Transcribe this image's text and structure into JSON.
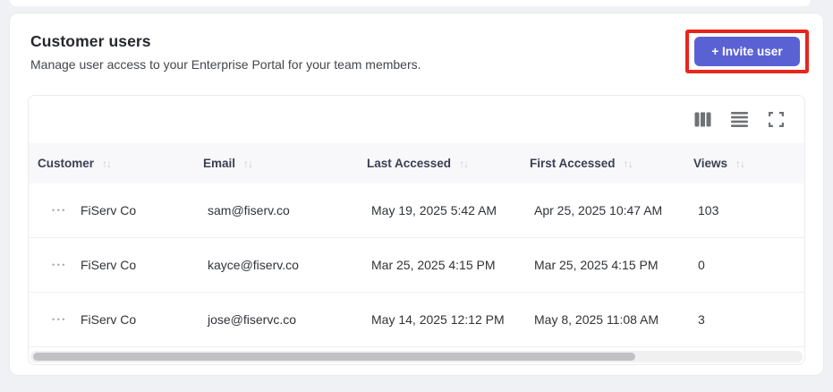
{
  "header": {
    "title": "Customer users",
    "subtitle": "Manage user access to your Enterprise Portal for your team members.",
    "invite_button_label": "+ Invite user"
  },
  "colors": {
    "accent": "#5a62d3",
    "annotation_red": "#e8251c",
    "header_row_bg": "#f8f8fb"
  },
  "toolbar": {
    "icons": [
      "columns-icon",
      "rows-icon",
      "fullscreen-icon"
    ]
  },
  "table": {
    "sort_icon": "↑↓",
    "row_menu_icon": "•••",
    "columns": [
      {
        "label": "Customer"
      },
      {
        "label": "Email"
      },
      {
        "label": "Last Accessed"
      },
      {
        "label": "First Accessed"
      },
      {
        "label": "Views"
      }
    ],
    "rows": [
      {
        "customer": "FiServ Co",
        "email": "sam@fiserv.co",
        "last_accessed": "May 19, 2025 5:42 AM",
        "first_accessed": "Apr 25, 2025 10:47 AM",
        "views": "103"
      },
      {
        "customer": "FiServ Co",
        "email": "kayce@fiserv.co",
        "last_accessed": "Mar 25, 2025 4:15 PM",
        "first_accessed": "Mar 25, 2025 4:15 PM",
        "views": "0"
      },
      {
        "customer": "FiServ Co",
        "email": "jose@fiservc.co",
        "last_accessed": "May 14, 2025 12:12 PM",
        "first_accessed": "May 8, 2025 11:08 AM",
        "views": "3"
      }
    ],
    "scrollbar": {
      "thumb_percent": 78
    }
  }
}
